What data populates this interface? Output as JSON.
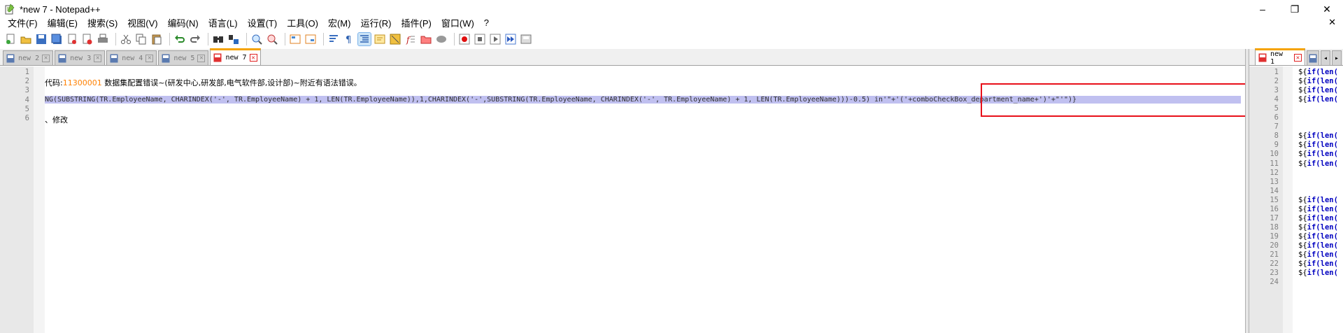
{
  "window": {
    "title": "*new 7 - Notepad++",
    "controls": [
      "–",
      "❐",
      "✕"
    ],
    "doc_close": "✕"
  },
  "menu": [
    "文件(F)",
    "编辑(E)",
    "搜索(S)",
    "视图(V)",
    "编码(N)",
    "语言(L)",
    "设置(T)",
    "工具(O)",
    "宏(M)",
    "运行(R)",
    "插件(P)",
    "窗口(W)",
    "?"
  ],
  "toolbar_icons": [
    "new-file-icon",
    "open-file-icon",
    "save-icon",
    "save-all-icon",
    "close-icon",
    "close-all-icon",
    "print-icon",
    "cut-icon",
    "copy-icon",
    "paste-icon",
    "undo-icon",
    "redo-icon",
    "find-icon",
    "replace-icon",
    "zoom-in-icon",
    "zoom-out-icon",
    "sync-vertical-icon",
    "sync-horizontal-icon",
    "word-wrap-icon",
    "show-all-chars-icon",
    "indent-guide-icon",
    "udl-icon",
    "doc-map-icon",
    "function-list-icon",
    "folder-workspace-icon",
    "monitoring-icon",
    "record-macro-icon",
    "stop-macro-icon",
    "play-macro-icon",
    "run-macro-multiple-icon",
    "save-macro-icon"
  ],
  "left_tabs": [
    {
      "label": "new 2",
      "active": false
    },
    {
      "label": "new 3",
      "active": false
    },
    {
      "label": "new 4",
      "active": false
    },
    {
      "label": "new 5",
      "active": false
    },
    {
      "label": "new 7",
      "active": true
    }
  ],
  "right_tabs": [
    {
      "label": "new 1",
      "active": true
    }
  ],
  "tab_close_glyph": "✕",
  "tab_nav": [
    "◂",
    "▸"
  ],
  "left_editor": {
    "line_numbers": [
      "1",
      "2",
      "3",
      "4",
      "5",
      "6"
    ],
    "line2_pre": "代码:",
    "line2_code": "11300001",
    "line2_post": " 数据集配置错误~(研发中心,研发部,电气软件部,设计部)~附近有语法错误。",
    "line4_main": "NG(SUBSTRING(TR.EmployeeName, CHARINDEX('-', TR.EmployeeName) + 1, LEN(TR.EmployeeName)),1,CHARINDEX('-',SUBSTRING(TR.EmployeeName, CHARINDEX('-', TR.EmployeeName) + 1, LEN(TR.EmployeeName)))-0.5) in'\"+'('+comboCheckBox_department_name+')'+\"'\")}",
    "line6": "、修改"
  },
  "right_editor": {
    "line_numbers": [
      "1",
      "2",
      "3",
      "4",
      "5",
      "6",
      "7",
      "8",
      "9",
      "10",
      "11",
      "12",
      "13",
      "14",
      "15",
      "16",
      "17",
      "18",
      "19",
      "20",
      "21",
      "22",
      "23",
      "24"
    ],
    "code_prefix": "${",
    "code_kw": "if(len(",
    "code_lines": [
      1,
      2,
      3,
      4,
      8,
      9,
      10,
      11,
      15,
      16,
      17,
      18,
      19,
      20,
      21,
      22,
      23
    ]
  }
}
